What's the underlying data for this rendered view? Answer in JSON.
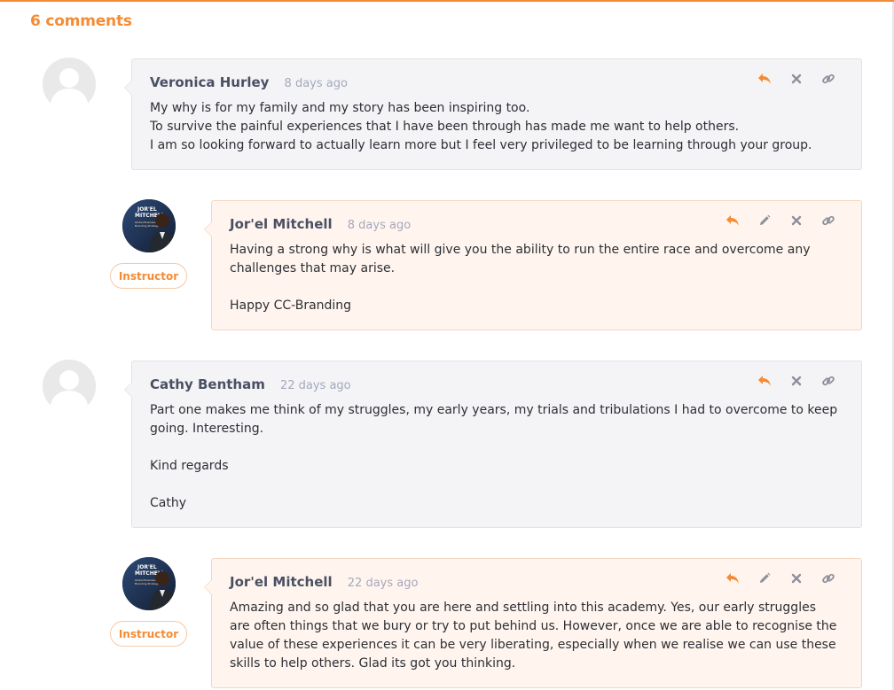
{
  "header": {
    "comment_count_label": "6 comments"
  },
  "badges": {
    "instructor": "Instructor"
  },
  "colors": {
    "accent": "#f58b33",
    "member_bubble": "#f4f4f6",
    "instructor_bubble": "#fff5ee",
    "timestamp": "#a4a8bd",
    "author": "#4a5063"
  },
  "comments": [
    {
      "author": "Veronica Hurley",
      "time": "8 days ago",
      "role": "member",
      "avatar_icon": "default-user-avatar-icon",
      "lines": [
        "My why is for my family and my story has been inspiring too.",
        "To survive the painful experiences that I have been through has made me want to help others.",
        "I am so looking forward to actually learn more but I feel very privileged to be learning through your group."
      ],
      "actions": [
        "reply-icon",
        "delete-icon",
        "permalink-icon"
      ]
    },
    {
      "author": "Jor'el Mitchell",
      "time": "8 days ago",
      "role": "instructor",
      "avatar_icon": "instructor-photo-avatar",
      "avatar_text": [
        "JOR'EL",
        "MITCHELL",
        "Global Business &",
        "Branding Strategist"
      ],
      "paragraphs": [
        "Having a strong why is what will give you the ability to run the entire race and overcome any challenges that may arise.",
        "Happy CC-Branding"
      ],
      "actions": [
        "reply-icon",
        "edit-icon",
        "delete-icon",
        "permalink-icon"
      ]
    },
    {
      "author": "Cathy Bentham",
      "time": "22 days ago",
      "role": "member",
      "avatar_icon": "default-user-avatar-icon",
      "paragraphs": [
        "Part one makes me think of my struggles, my early years, my trials and tribulations I had to overcome to keep going. Interesting.",
        "Kind regards",
        "Cathy"
      ],
      "actions": [
        "reply-icon",
        "delete-icon",
        "permalink-icon"
      ]
    },
    {
      "author": "Jor'el Mitchell",
      "time": "22 days ago",
      "role": "instructor",
      "avatar_icon": "instructor-photo-avatar",
      "avatar_text": [
        "JOR'EL",
        "MITCHELL",
        "Global Business &",
        "Branding Strategist"
      ],
      "paragraphs": [
        "Amazing and so glad that you are here and settling into this academy. Yes, our early struggles are often things that we bury or try to put behind us. However, once we are able to recognise the value of these experiences it can be very liberating, especially when we realise we can use these skills to help others. Glad its got you thinking."
      ],
      "actions": [
        "reply-icon",
        "edit-icon",
        "delete-icon",
        "permalink-icon"
      ]
    }
  ]
}
